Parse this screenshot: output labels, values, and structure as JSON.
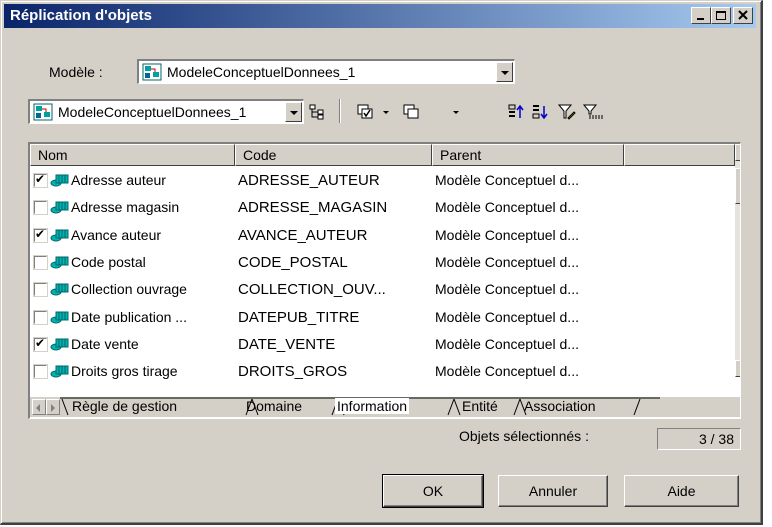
{
  "window": {
    "title": "Réplication d'objets",
    "minimize_glyph": "_",
    "maximize_glyph": "□",
    "close_glyph": "×"
  },
  "model_selector": {
    "label": "Modèle :",
    "value": "ModeleConceptuelDonnees_1",
    "icon": "model-icon"
  },
  "toolbar": {
    "package_value": "ModeleConceptuelDonnees_1",
    "icons": [
      "model-icon",
      "tree-hierarchy-icon",
      "select-all-icon",
      "deselect-all-icon",
      "move-to-top-icon",
      "move-to-bottom-icon",
      "filter-icon",
      "clear-filter-icon"
    ]
  },
  "list": {
    "columns": [
      "Nom",
      "Code",
      "Parent"
    ],
    "rows": [
      {
        "checked": true,
        "name": "Adresse auteur",
        "code": "ADRESSE_AUTEUR",
        "parent": "Modèle Conceptuel d..."
      },
      {
        "checked": false,
        "name": "Adresse magasin",
        "code": "ADRESSE_MAGASIN",
        "parent": "Modèle Conceptuel d..."
      },
      {
        "checked": true,
        "name": "Avance auteur",
        "code": "AVANCE_AUTEUR",
        "parent": "Modèle Conceptuel d..."
      },
      {
        "checked": false,
        "name": "Code postal",
        "code": "CODE_POSTAL",
        "parent": "Modèle Conceptuel d..."
      },
      {
        "checked": false,
        "name": "Collection ouvrage",
        "code": "COLLECTION_OUV...",
        "parent": "Modèle Conceptuel d..."
      },
      {
        "checked": false,
        "name": "Date publication ...",
        "code": "DATEPUB_TITRE",
        "parent": "Modèle Conceptuel d..."
      },
      {
        "checked": true,
        "name": "Date vente",
        "code": "DATE_VENTE",
        "parent": "Modèle Conceptuel d..."
      },
      {
        "checked": false,
        "name": "Droits gros tirage",
        "code": "DROITS_GROS",
        "parent": "Modèle Conceptuel d..."
      }
    ],
    "tabs": [
      "Règle de gestion",
      "Domaine",
      "Information",
      "Entité",
      "Association"
    ],
    "active_tab": "Information"
  },
  "status": {
    "label": "Objets sélectionnés :",
    "value": "3 / 38"
  },
  "buttons": {
    "ok": "OK",
    "cancel": "Annuler",
    "help": "Aide"
  },
  "colors": {
    "dialog_bg": "#d4d0c8",
    "title_start": "#0a246a",
    "title_end": "#a6caf0",
    "entity_icon": "#009999"
  }
}
